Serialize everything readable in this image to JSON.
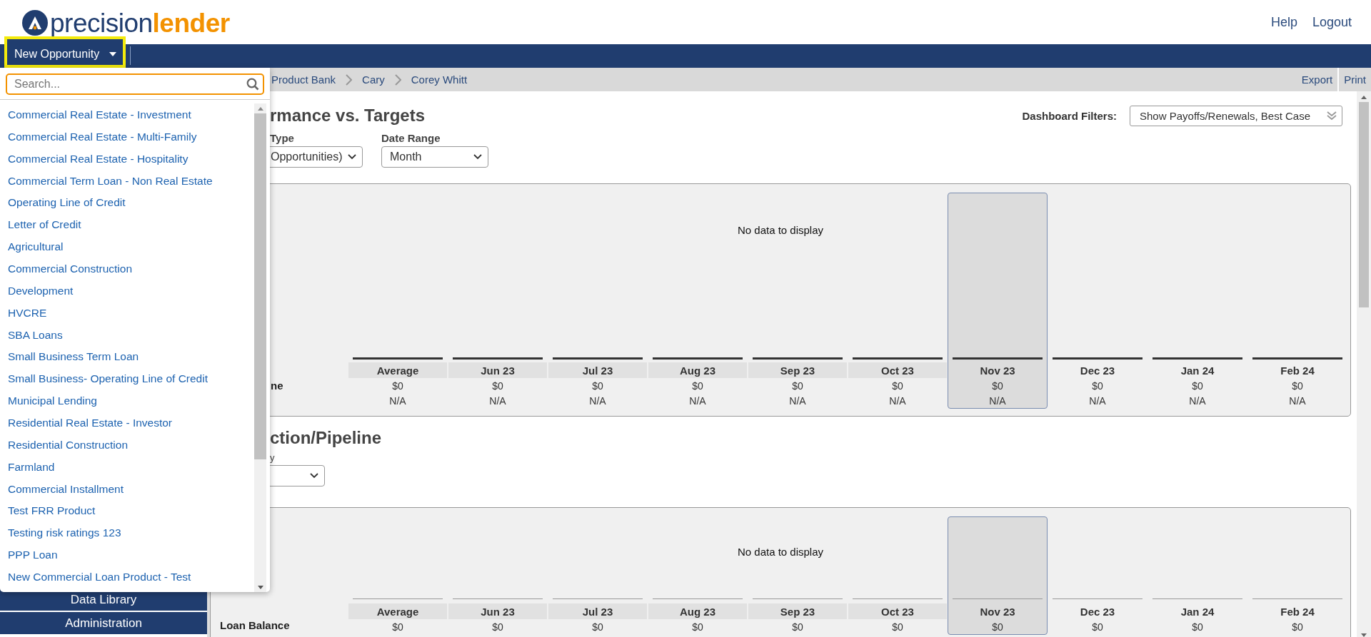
{
  "logo": {
    "main": "precision",
    "accent": "lender"
  },
  "top_links": [
    "Help",
    "Logout"
  ],
  "new_opportunity": {
    "label": "New Opportunity",
    "expanded": true
  },
  "breadcrumb": [
    "Product Bank",
    "Cary",
    "Corey Whitt"
  ],
  "toolbar_actions": [
    "Export",
    "Print"
  ],
  "dropdown": {
    "search": {
      "placeholder": "Search..."
    },
    "items": [
      "Commercial Real Estate - Investment",
      "Commercial Real Estate - Multi-Family",
      "Commercial Real Estate - Hospitality",
      "Commercial Term Loan - Non Real Estate",
      "Operating Line of Credit",
      "Letter of Credit",
      "Agricultural",
      "Commercial Construction",
      "Development",
      "HVCRE",
      "SBA Loans",
      "Small Business Term Loan",
      "Small Business- Operating Line of Credit",
      "Municipal Lending",
      "Residential Real Estate - Investor",
      "Residential Construction",
      "Farmland",
      "Commercial Installment",
      "Test FRR Product",
      "Testing risk ratings 123",
      "PPP Loan",
      "New Commercial Loan Product - Test"
    ]
  },
  "sidebar": {
    "items": [
      "Data Library",
      "Administration"
    ]
  },
  "dashboard_filters": {
    "label": "Dashboard Filters:",
    "value": "Show Payoffs/Renewals, Best Case"
  },
  "sections": [
    {
      "title": "rmance vs. Targets",
      "filters": [
        {
          "label": "Type",
          "value": "Opportunities)"
        },
        {
          "label": "Date Range",
          "value": "Month"
        }
      ],
      "panel": {
        "kind": "targets",
        "empty_message": "No data to display",
        "columns": [
          {
            "label": "Average",
            "selected": false,
            "shaded": true
          },
          {
            "label": "Jun 23",
            "selected": false,
            "shaded": true
          },
          {
            "label": "Jul 23",
            "selected": false,
            "shaded": true
          },
          {
            "label": "Aug 23",
            "selected": false,
            "shaded": true
          },
          {
            "label": "Sep 23",
            "selected": false,
            "shaded": true
          },
          {
            "label": "Oct 23",
            "selected": false,
            "shaded": true
          },
          {
            "label": "Nov 23",
            "selected": true,
            "shaded": false
          },
          {
            "label": "Dec 23",
            "selected": false,
            "shaded": false
          },
          {
            "label": "Jan 24",
            "selected": false,
            "shaded": false
          },
          {
            "label": "Feb 24",
            "selected": false,
            "shaded": false
          }
        ],
        "rows": [
          {
            "label": "ne",
            "values": [
              "$0",
              "$0",
              "$0",
              "$0",
              "$0",
              "$0",
              "$0",
              "$0",
              "$0",
              "$0"
            ]
          },
          {
            "values": [
              "N/A",
              "N/A",
              "N/A",
              "N/A",
              "N/A",
              "N/A",
              "N/A",
              "N/A",
              "N/A",
              "N/A"
            ]
          }
        ]
      }
    },
    {
      "title": "ction/Pipeline",
      "filters": [
        {
          "label": "y"
        }
      ],
      "panel": {
        "kind": "pipeline",
        "empty_message": "No data to display",
        "columns": [
          {
            "label": "Average",
            "selected": false,
            "shaded": true
          },
          {
            "label": "Jun 23",
            "selected": false,
            "shaded": true
          },
          {
            "label": "Jul 23",
            "selected": false,
            "shaded": true
          },
          {
            "label": "Aug 23",
            "selected": false,
            "shaded": true
          },
          {
            "label": "Sep 23",
            "selected": false,
            "shaded": true
          },
          {
            "label": "Oct 23",
            "selected": false,
            "shaded": true
          },
          {
            "label": "Nov 23",
            "selected": true,
            "shaded": false
          },
          {
            "label": "Dec 23",
            "selected": false,
            "shaded": false
          },
          {
            "label": "Jan 24",
            "selected": false,
            "shaded": false
          },
          {
            "label": "Feb 24",
            "selected": false,
            "shaded": false
          }
        ],
        "rows": [
          {
            "label": "Loan Balance",
            "values": [
              "$0",
              "$0",
              "$0",
              "$0",
              "$0",
              "$0",
              "$0",
              "$0",
              "$0",
              "$0"
            ]
          }
        ]
      }
    }
  ]
}
